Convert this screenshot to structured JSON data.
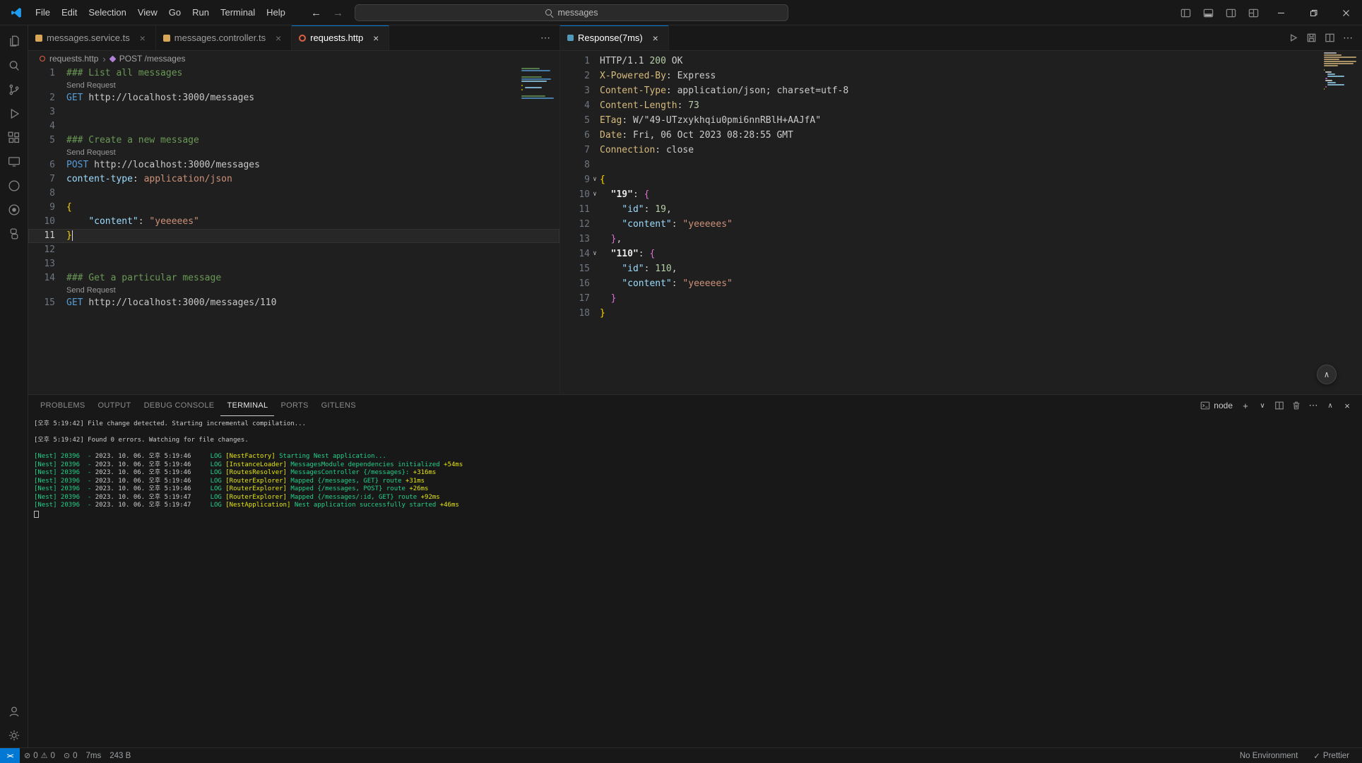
{
  "titlebar": {
    "menus": [
      "File",
      "Edit",
      "Selection",
      "View",
      "Go",
      "Run",
      "Terminal",
      "Help"
    ],
    "search_value": "messages"
  },
  "activity_bar": {
    "top": [
      "explorer-icon",
      "search-icon",
      "source-control-icon",
      "run-debug-icon",
      "extensions-icon",
      "remote-explorer-icon",
      "extension-circle-icon",
      "extension-target-icon",
      "python-icon"
    ],
    "bottom": [
      "accounts-icon",
      "settings-gear-icon"
    ]
  },
  "editor_left": {
    "tabs": [
      {
        "label": "messages.service.ts",
        "active": false
      },
      {
        "label": "messages.controller.ts",
        "active": false
      },
      {
        "label": "requests.http",
        "active": true
      }
    ],
    "breadcrumb": {
      "file": "requests.http",
      "symbol": "POST /messages"
    },
    "codelens_label": "Send Request",
    "lines": [
      {
        "n": 1,
        "t": [
          [
            "### List all messages",
            "c"
          ]
        ]
      },
      {
        "lens": true
      },
      {
        "n": 2,
        "t": [
          [
            "GET ",
            "k"
          ],
          [
            "http://localhost:3000/messages",
            "u"
          ]
        ]
      },
      {
        "n": 3,
        "t": []
      },
      {
        "n": 4,
        "t": []
      },
      {
        "n": 5,
        "t": [
          [
            "### Create a new message",
            "c"
          ]
        ]
      },
      {
        "lens": true
      },
      {
        "n": 6,
        "t": [
          [
            "POST ",
            "k"
          ],
          [
            "http://localhost:3000/messages",
            "u"
          ]
        ]
      },
      {
        "n": 7,
        "t": [
          [
            "content-type",
            "p"
          ],
          [
            ": ",
            "d"
          ],
          [
            "application/json",
            "s"
          ]
        ]
      },
      {
        "n": 8,
        "t": []
      },
      {
        "n": 9,
        "t": [
          [
            "{",
            "b1"
          ]
        ]
      },
      {
        "n": 10,
        "t": [
          [
            "    ",
            "d"
          ],
          [
            "\"content\"",
            "p"
          ],
          [
            ": ",
            "d"
          ],
          [
            "\"yeeeees\"",
            "s"
          ]
        ]
      },
      {
        "n": 11,
        "cur": true,
        "t": [
          [
            "}",
            "b1"
          ]
        ]
      },
      {
        "n": 12,
        "t": []
      },
      {
        "n": 13,
        "t": []
      },
      {
        "n": 14,
        "t": [
          [
            "### Get a particular message",
            "c"
          ]
        ]
      },
      {
        "lens": true
      },
      {
        "n": 15,
        "t": [
          [
            "GET ",
            "k"
          ],
          [
            "http://localhost:3000/messages/110",
            "u"
          ]
        ]
      }
    ]
  },
  "editor_right": {
    "tab_label": "Response(7ms)",
    "lines": [
      {
        "n": 1,
        "t": [
          [
            "HTTP/1.1 ",
            "d"
          ],
          [
            "200",
            "n"
          ],
          [
            " OK",
            "d"
          ]
        ]
      },
      {
        "n": 2,
        "t": [
          [
            "X-Powered-By",
            "h"
          ],
          [
            ": ",
            "d"
          ],
          [
            "Express",
            "d"
          ]
        ]
      },
      {
        "n": 3,
        "t": [
          [
            "Content-Type",
            "h"
          ],
          [
            ": ",
            "d"
          ],
          [
            "application/json; charset=utf-8",
            "d"
          ]
        ]
      },
      {
        "n": 4,
        "t": [
          [
            "Content-Length",
            "h"
          ],
          [
            ": ",
            "d"
          ],
          [
            "73",
            "n"
          ]
        ]
      },
      {
        "n": 5,
        "t": [
          [
            "ETag",
            "h"
          ],
          [
            ": ",
            "d"
          ],
          [
            "W/\"49-UTzxykhqiu0pmi6nnRBlH+AAJfA\"",
            "d"
          ]
        ]
      },
      {
        "n": 6,
        "t": [
          [
            "Date",
            "h"
          ],
          [
            ": ",
            "d"
          ],
          [
            "Fri, 06 Oct 2023 08:28:55 GMT",
            "d"
          ]
        ]
      },
      {
        "n": 7,
        "t": [
          [
            "Connection",
            "h"
          ],
          [
            ": ",
            "d"
          ],
          [
            "close",
            "d"
          ]
        ]
      },
      {
        "n": 8,
        "t": []
      },
      {
        "n": 9,
        "f": 1,
        "t": [
          [
            "{",
            "b1"
          ]
        ]
      },
      {
        "n": 10,
        "f": 1,
        "t": [
          [
            "  ",
            "d"
          ],
          [
            "\"19\"",
            "key"
          ],
          [
            ": ",
            "d"
          ],
          [
            "{",
            "b2"
          ]
        ]
      },
      {
        "n": 11,
        "t": [
          [
            "    ",
            "d"
          ],
          [
            "\"id\"",
            "p"
          ],
          [
            ": ",
            "d"
          ],
          [
            "19",
            "n"
          ],
          [
            ",",
            "d"
          ]
        ]
      },
      {
        "n": 12,
        "t": [
          [
            "    ",
            "d"
          ],
          [
            "\"content\"",
            "p"
          ],
          [
            ": ",
            "d"
          ],
          [
            "\"yeeeees\"",
            "s"
          ]
        ]
      },
      {
        "n": 13,
        "t": [
          [
            "  ",
            "d"
          ],
          [
            "}",
            "b2"
          ],
          [
            ",",
            "d"
          ]
        ]
      },
      {
        "n": 14,
        "f": 1,
        "t": [
          [
            "  ",
            "d"
          ],
          [
            "\"110\"",
            "key"
          ],
          [
            ": ",
            "d"
          ],
          [
            "{",
            "b2"
          ]
        ]
      },
      {
        "n": 15,
        "t": [
          [
            "    ",
            "d"
          ],
          [
            "\"id\"",
            "p"
          ],
          [
            ": ",
            "d"
          ],
          [
            "110",
            "n"
          ],
          [
            ",",
            "d"
          ]
        ]
      },
      {
        "n": 16,
        "t": [
          [
            "    ",
            "d"
          ],
          [
            "\"content\"",
            "p"
          ],
          [
            ": ",
            "d"
          ],
          [
            "\"yeeeees\"",
            "s"
          ]
        ]
      },
      {
        "n": 17,
        "t": [
          [
            "  ",
            "d"
          ],
          [
            "}",
            "b2"
          ]
        ]
      },
      {
        "n": 18,
        "t": [
          [
            "}",
            "b1"
          ]
        ]
      }
    ]
  },
  "panel": {
    "tabs": [
      "PROBLEMS",
      "OUTPUT",
      "DEBUG CONSOLE",
      "TERMINAL",
      "PORTS",
      "GITLENS"
    ],
    "active_tab": "TERMINAL",
    "terminal": {
      "profile": "node",
      "lines": [
        {
          "t": [
            [
              "[오후 5:19:42] File change detected. Starting incremental compilation...",
              "d"
            ]
          ]
        },
        {
          "t": []
        },
        {
          "t": [
            [
              "[오후 5:19:42] Found 0 errors. Watching for file changes.",
              "d"
            ]
          ]
        },
        {
          "t": []
        },
        {
          "t": [
            [
              "[Nest] 20396  - ",
              "g"
            ],
            [
              "2023. 10. 06. 오후 5:19:46",
              "d"
            ],
            [
              "     LOG ",
              "g"
            ],
            [
              "[NestFactory] ",
              "y"
            ],
            [
              "Starting Nest application...",
              "g"
            ]
          ]
        },
        {
          "t": [
            [
              "[Nest] 20396  - ",
              "g"
            ],
            [
              "2023. 10. 06. 오후 5:19:46",
              "d"
            ],
            [
              "     LOG ",
              "g"
            ],
            [
              "[InstanceLoader] ",
              "y"
            ],
            [
              "MessagesModule dependencies initialized ",
              "g"
            ],
            [
              "+54ms",
              "y"
            ]
          ]
        },
        {
          "t": [
            [
              "[Nest] 20396  - ",
              "g"
            ],
            [
              "2023. 10. 06. 오후 5:19:46",
              "d"
            ],
            [
              "     LOG ",
              "g"
            ],
            [
              "[RoutesResolver] ",
              "y"
            ],
            [
              "MessagesController {/messages}: ",
              "g"
            ],
            [
              "+316ms",
              "y"
            ]
          ]
        },
        {
          "t": [
            [
              "[Nest] 20396  - ",
              "g"
            ],
            [
              "2023. 10. 06. 오후 5:19:46",
              "d"
            ],
            [
              "     LOG ",
              "g"
            ],
            [
              "[RouterExplorer] ",
              "y"
            ],
            [
              "Mapped {/messages, GET} route ",
              "g"
            ],
            [
              "+31ms",
              "y"
            ]
          ]
        },
        {
          "t": [
            [
              "[Nest] 20396  - ",
              "g"
            ],
            [
              "2023. 10. 06. 오후 5:19:46",
              "d"
            ],
            [
              "     LOG ",
              "g"
            ],
            [
              "[RouterExplorer] ",
              "y"
            ],
            [
              "Mapped {/messages, POST} route ",
              "g"
            ],
            [
              "+26ms",
              "y"
            ]
          ]
        },
        {
          "t": [
            [
              "[Nest] 20396  - ",
              "g"
            ],
            [
              "2023. 10. 06. 오후 5:19:47",
              "d"
            ],
            [
              "     LOG ",
              "g"
            ],
            [
              "[RouterExplorer] ",
              "y"
            ],
            [
              "Mapped {/messages/:id, GET} route ",
              "g"
            ],
            [
              "+92ms",
              "y"
            ]
          ]
        },
        {
          "t": [
            [
              "[Nest] 20396  - ",
              "g"
            ],
            [
              "2023. 10. 06. 오후 5:19:47",
              "d"
            ],
            [
              "     LOG ",
              "g"
            ],
            [
              "[NestApplication] ",
              "y"
            ],
            [
              "Nest application successfully started ",
              "g"
            ],
            [
              "+46ms",
              "y"
            ]
          ]
        },
        {
          "cursor": true,
          "t": []
        }
      ]
    }
  },
  "status_bar": {
    "remote_icon": "><",
    "errors": "0",
    "warnings": "0",
    "ports": "0",
    "response_time": "7ms",
    "response_size": "243 B",
    "environment": "No Environment",
    "formatter_check": "✓",
    "formatter": "Prettier"
  },
  "icons": {
    "back": "←",
    "forward": "→",
    "close": "×",
    "more": "⋯",
    "plus": "+",
    "chevron_down": "∨",
    "chevron_up": "∧",
    "breadcrumb_sep": "›",
    "error": "⊘",
    "warning": "⚠",
    "ports": "⊙"
  },
  "colors": {
    "accent_blue": "#0078d4",
    "tokens": {
      "c": "#6a9955",
      "k": "#569cd6",
      "u": "#c8c8c8",
      "p": "#9cdcfe",
      "s": "#ce9178",
      "d": "#cccccc",
      "n": "#b5cea8",
      "h": "#d7ba7d",
      "b1": "#ffd700",
      "b2": "#da70d6",
      "key": "#e8e8e8"
    },
    "terminal": {
      "d": "#cccccc",
      "g": "#23d18b",
      "y": "#e5e510"
    }
  }
}
